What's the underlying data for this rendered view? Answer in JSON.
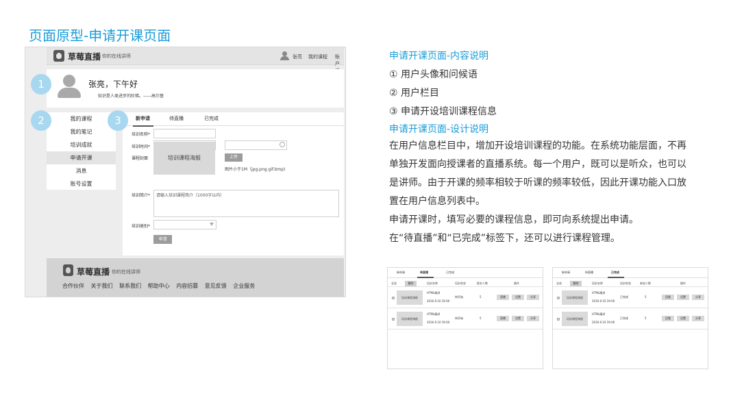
{
  "slide": {
    "title": "页面原型-申请开课页面"
  },
  "mock": {
    "header": {
      "logo_text": "草莓直播",
      "logo_sub": "你的在线讲师",
      "user_name": "张亮",
      "links": [
        "我的课程",
        "账户设置"
      ]
    },
    "greeting": {
      "name": "张亮，下午好",
      "quote": "知识是人类进步的阶梯。——高尔基"
    },
    "sidebar": {
      "items": [
        "我的课程",
        "我的笔记",
        "培训成就",
        "申请开课",
        "消息",
        "账号设置"
      ],
      "active_index": 3
    },
    "tabs": [
      "新申请",
      "待直播",
      "已完成"
    ],
    "form": {
      "name_label": "培训名称*",
      "time_label": "培训时间*",
      "cover_label": "课程封面",
      "cover_placeholder": "培训课程海报",
      "upload_button": "上传",
      "upload_hint": "图片小于1M（jpg.png.gif.bmp)",
      "intro_label": "培训简介*",
      "intro_placeholder": "请输入培训课程简介（1000字以内）",
      "category_label": "培训类别*",
      "submit_button": "申请"
    },
    "footer": {
      "logo_text": "草莓直播",
      "logo_sub": "你的在线讲师",
      "links": [
        "合作伙伴",
        "关于我们",
        "联系我们",
        "帮助中心",
        "内容招募",
        "意见反馈",
        "企业服务"
      ]
    },
    "badges": [
      "1",
      "2",
      "3"
    ]
  },
  "description": {
    "heading1": "申请开课页面-内容说明",
    "items": [
      "①  用户头像和问候语",
      "②  用户栏目",
      "③  申请开设培训课程信息"
    ],
    "heading2": "申请开课页面-设计说明",
    "lines": [
      "在用户信息栏目中，增加开设培训课程的功能。在系统功能层面，不再",
      "单独开发面向授课者的直播系统。每一个用户，既可以是听众，也可以",
      "是讲师。由于开课的频率相较于听课的频率较低，因此开课功能入口放",
      "置在用户信息列表中。",
      "申请开课时，填写必要的课程信息，即可向系统提出申请。",
      "在“待直播”和“已完成”标签下，还可以进行课程管理。"
    ]
  },
  "thumbnails": [
    {
      "tabs": [
        "新申请",
        "待直播",
        "已完成"
      ],
      "active_tab": 1,
      "headers": [
        "全选",
        "删除",
        "培训名称",
        "培训状态",
        "报名人数",
        "操作"
      ],
      "rows": [
        {
          "image": "培训课程海报",
          "name": "HTML精讲",
          "date": "2016.9.10 19:00",
          "status": "待开始",
          "count": "5",
          "actions": [
            "直播",
            "设置",
            "分享"
          ]
        },
        {
          "image": "培训课程海报",
          "name": "HTML精讲",
          "date": "2016.9.10 19:00",
          "status": "待开始",
          "count": "5",
          "actions": [
            "直播",
            "设置",
            "分享"
          ]
        }
      ]
    },
    {
      "tabs": [
        "新申请",
        "待直播",
        "已完成"
      ],
      "active_tab": 2,
      "headers": [
        "全选",
        "删除",
        "培训名称",
        "培训状态",
        "参加人数",
        "操作"
      ],
      "rows": [
        {
          "image": "培训课程海报",
          "name": "HTML精讲",
          "date": "2016.9.10 19:00",
          "status": "已完成",
          "count": "5",
          "actions": [
            "回看",
            "设置",
            "分享"
          ]
        },
        {
          "image": "培训课程海报",
          "name": "HTML精讲",
          "date": "2016.9.10 19:00",
          "status": "已完成",
          "count": "5",
          "actions": [
            "回看",
            "设置",
            "分享"
          ]
        }
      ]
    }
  ]
}
